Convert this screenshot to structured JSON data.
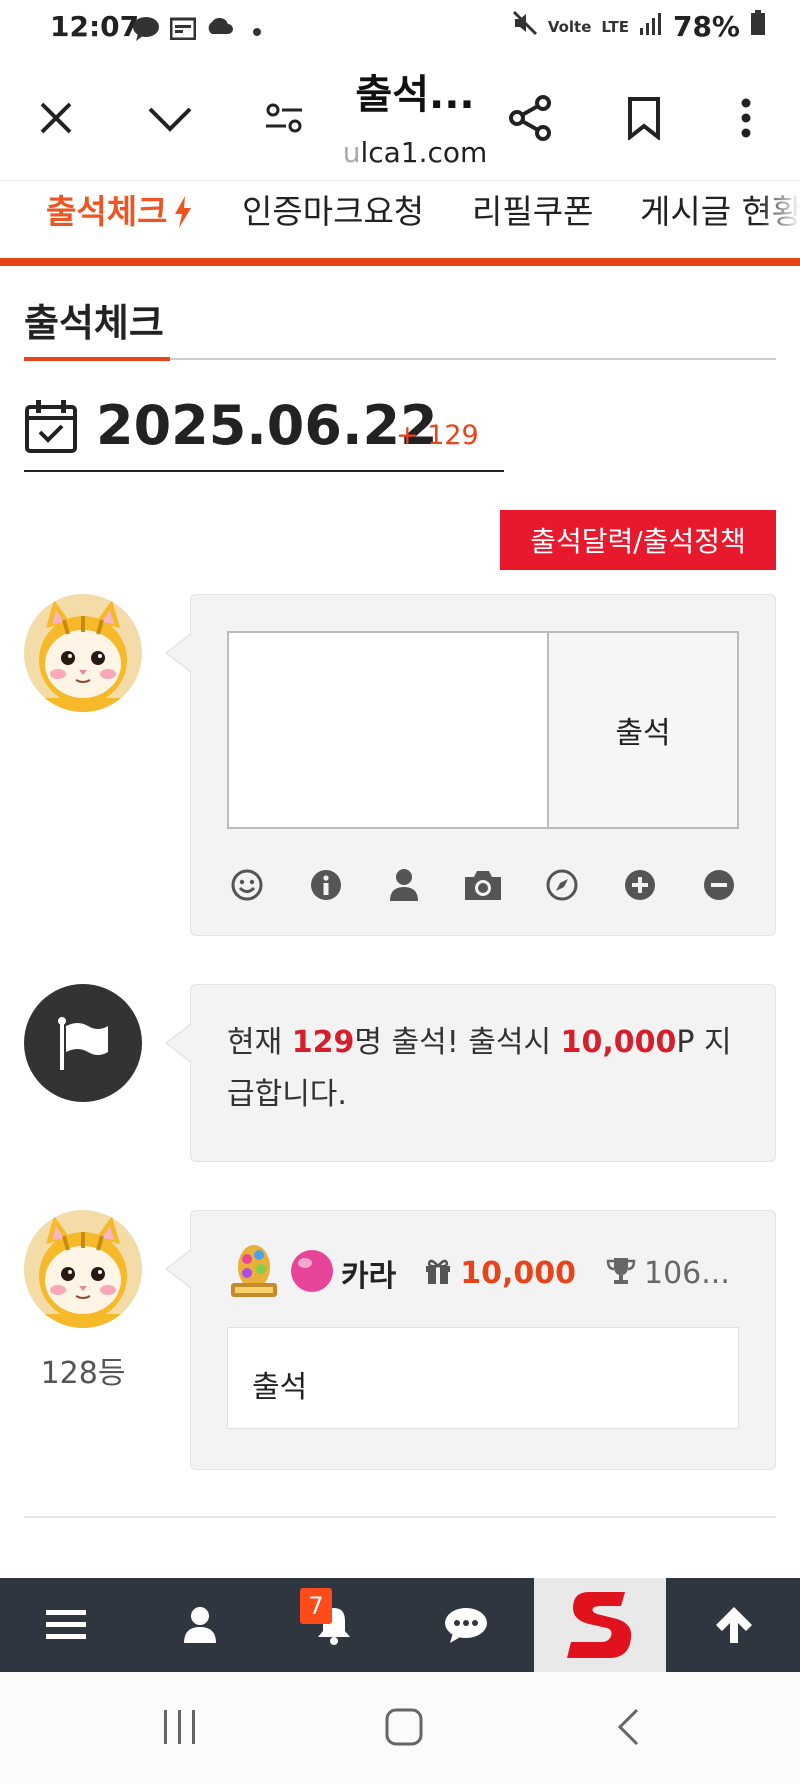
{
  "status_bar": {
    "time": "12:07",
    "volte_label": "Volte",
    "lte_label": "LTE",
    "battery": "78%"
  },
  "browser": {
    "title": "출석...",
    "url_prefix": "u",
    "url_rest": "lca1.com"
  },
  "menu": {
    "tabs": [
      {
        "label": "출석체크"
      },
      {
        "label": "인증마크요청"
      },
      {
        "label": "리필쿠폰"
      },
      {
        "label": "게시글 현황"
      }
    ]
  },
  "page": {
    "heading": "출석체크",
    "date": "2025.06.22",
    "plus_count": "+ 129",
    "policy_button": "출석달력/출석정책"
  },
  "attend_form": {
    "submit_label": "출석"
  },
  "notice": {
    "prefix": "현재 ",
    "count": "129",
    "mid": "명 출석! 출석시 ",
    "points": "10,000",
    "suffix": "P 지급합니다."
  },
  "entry": {
    "rank": "128등",
    "nickname": "카라",
    "point": "10,000",
    "trophy": "106...",
    "comment": "출석"
  },
  "bottom_bar": {
    "notification_count": "7"
  },
  "colors": {
    "accent_orange": "#e8441a",
    "policy_red": "#e8192c",
    "highlight_red": "#d61f2c",
    "bottom_bar_bg": "#2f3640"
  },
  "icons": {
    "tools": [
      "smile-icon",
      "info-icon",
      "user-icon",
      "camera-icon",
      "compass-icon",
      "plus-circle-icon",
      "minus-circle-icon"
    ]
  }
}
